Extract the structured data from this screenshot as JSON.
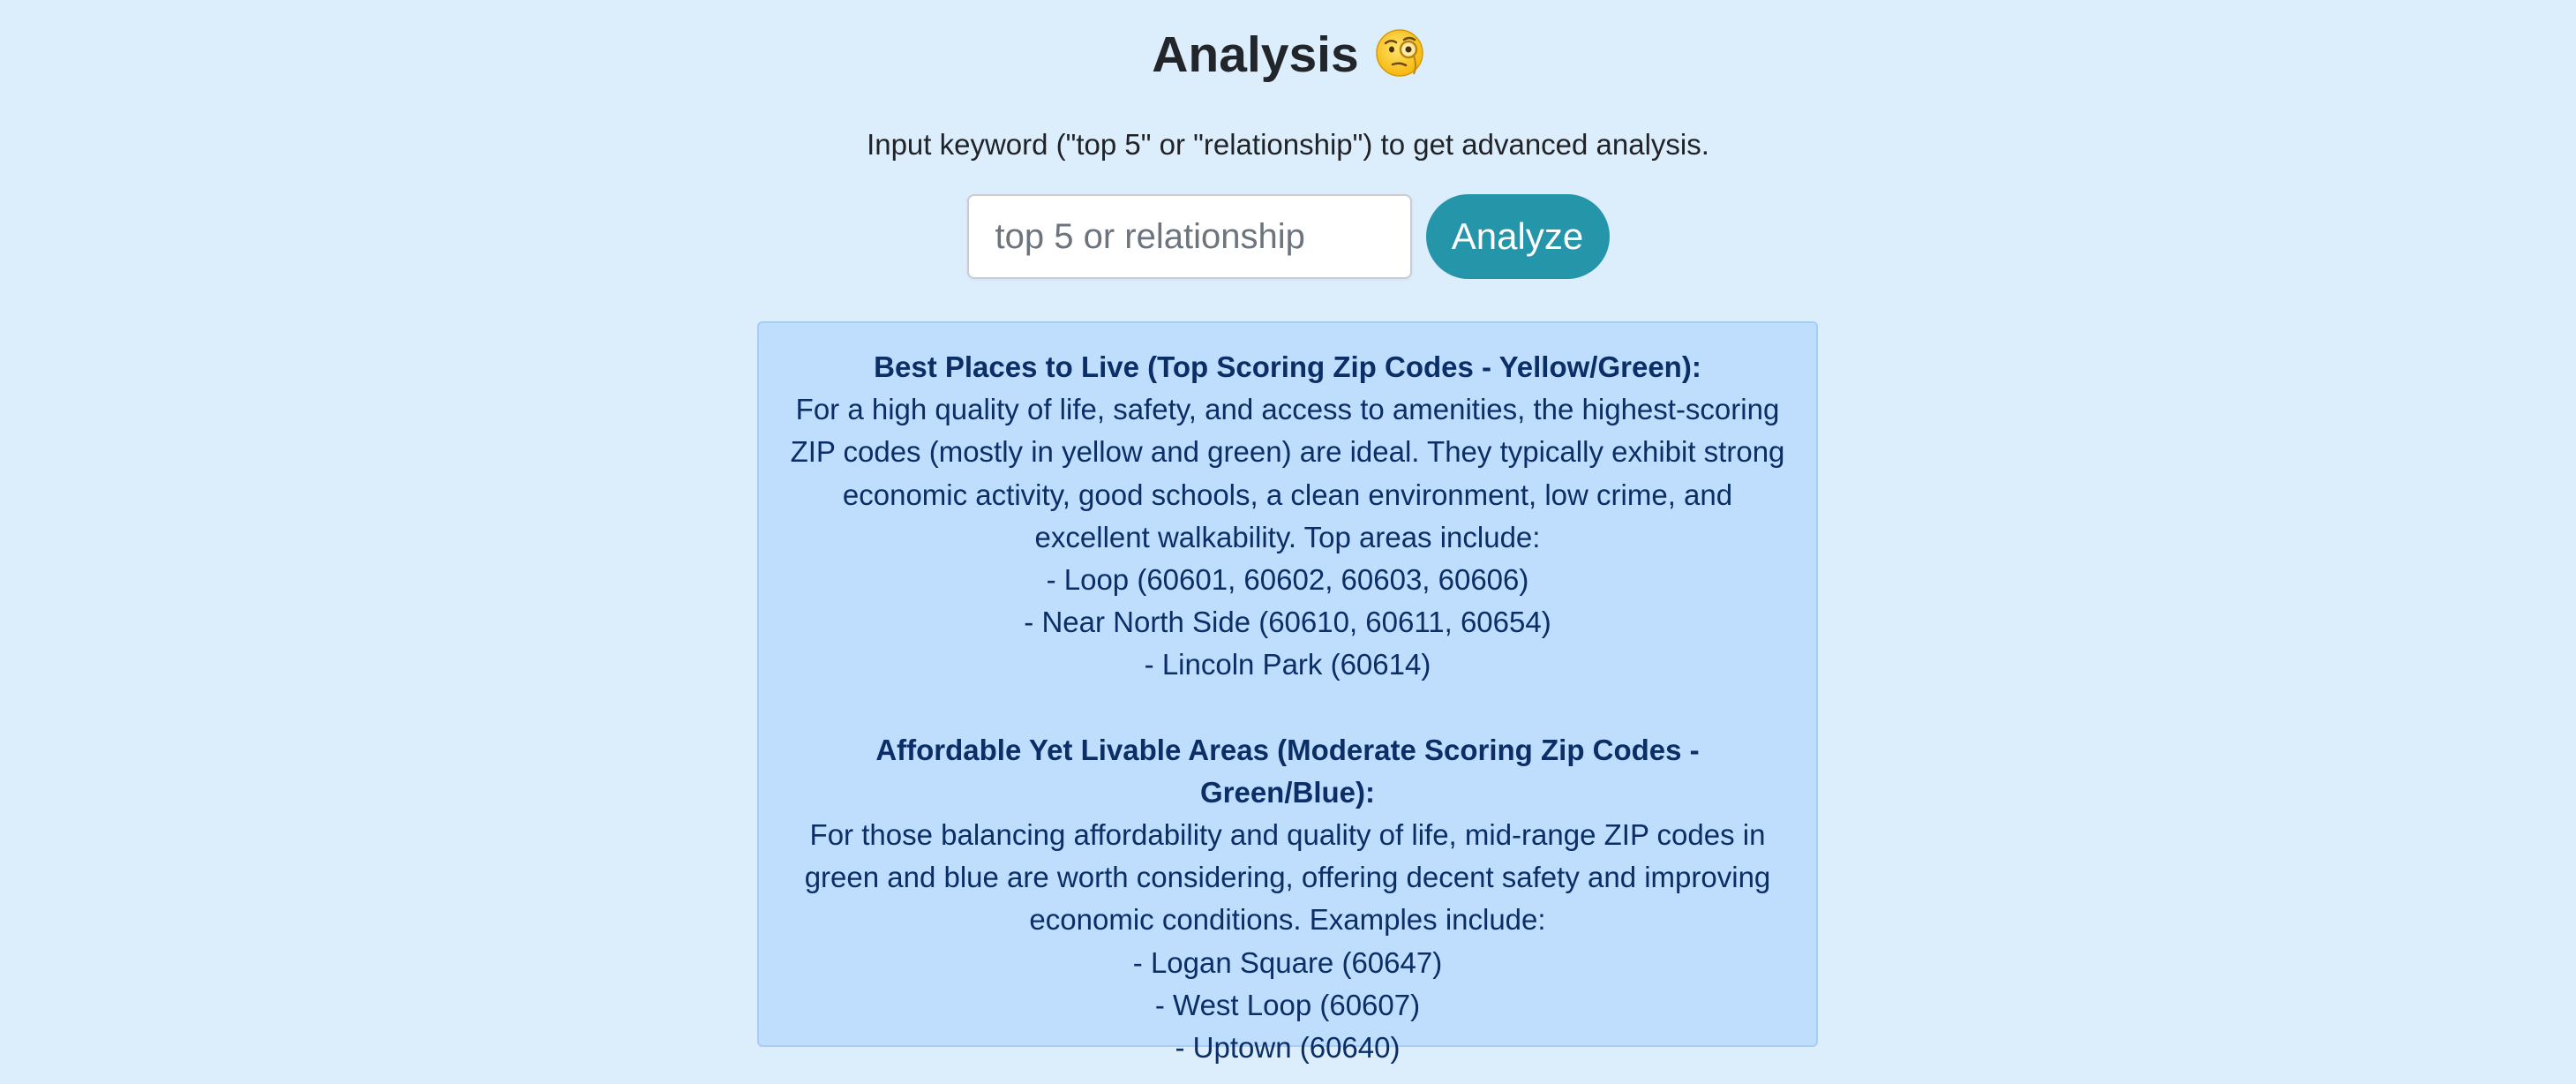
{
  "header": {
    "title": "Analysis",
    "title_emoji": "face-with-monocle"
  },
  "instructions": "Input keyword (\"top 5\" or \"relationship\") to get advanced analysis.",
  "search": {
    "value": "",
    "placeholder": "top 5 or relationship",
    "button_label": "Analyze"
  },
  "result": {
    "sections": [
      {
        "heading": "Best Places to Live (Top Scoring Zip Codes - Yellow/Green):",
        "lines": [
          "For a high quality of life, safety, and access to amenities, the highest-scoring",
          "ZIP codes (mostly in yellow and green) are ideal. They typically exhibit strong",
          "economic activity, good schools, a clean environment, low crime, and",
          "excellent walkability. Top areas include:",
          "- Loop (60601, 60602, 60603, 60606)",
          "- Near North Side (60610, 60611, 60654)",
          "- Lincoln Park (60614)"
        ]
      },
      {
        "heading": "Affordable Yet Livable Areas (Moderate Scoring Zip Codes - Green/Blue):",
        "lines": [
          "For those balancing affordability and quality of life, mid-range ZIP codes in",
          "green and blue are worth considering, offering decent safety and improving",
          "economic conditions. Examples include:",
          "- Logan Square (60647)",
          "- West Loop (60607)",
          "- Uptown (60640)"
        ]
      }
    ]
  },
  "colors": {
    "page_background": "#dcedfc",
    "accent_button": "#2595a9",
    "panel_background": "#bfdefd",
    "panel_text": "#0b2e66"
  }
}
